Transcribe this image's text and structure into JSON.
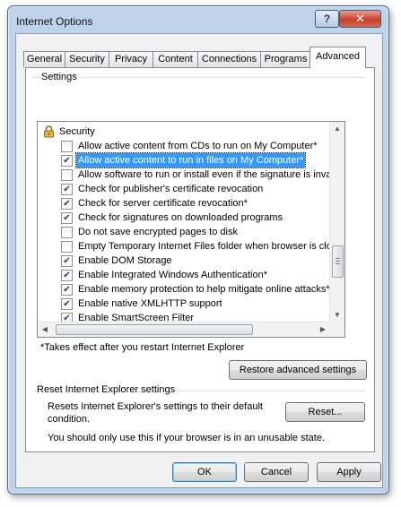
{
  "window": {
    "title": "Internet Options",
    "help_glyph": "?",
    "close_glyph": "✕"
  },
  "tabs": [
    "General",
    "Security",
    "Privacy",
    "Content",
    "Connections",
    "Programs",
    "Advanced"
  ],
  "active_tab": "Advanced",
  "settings_group": {
    "label": "Settings",
    "category": "Security",
    "category_icon": "padlock-icon",
    "items": [
      {
        "label": "Allow active content from CDs to run on My Computer*",
        "checked": false
      },
      {
        "label": "Allow active content to run in files on My Computer*",
        "checked": true,
        "selected": true
      },
      {
        "label": "Allow software to run or install even if the signature is invalid",
        "checked": false
      },
      {
        "label": "Check for publisher's certificate revocation",
        "checked": true
      },
      {
        "label": "Check for server certificate revocation*",
        "checked": true
      },
      {
        "label": "Check for signatures on downloaded programs",
        "checked": true
      },
      {
        "label": "Do not save encrypted pages to disk",
        "checked": false
      },
      {
        "label": "Empty Temporary Internet Files folder when browser is closed",
        "checked": false
      },
      {
        "label": "Enable DOM Storage",
        "checked": true
      },
      {
        "label": "Enable Integrated Windows Authentication*",
        "checked": true
      },
      {
        "label": "Enable memory protection to help mitigate online attacks*",
        "checked": true
      },
      {
        "label": "Enable native XMLHTTP support",
        "checked": true
      },
      {
        "label": "Enable SmartScreen Filter",
        "checked": true
      }
    ]
  },
  "restart_note": "*Takes effect after you restart Internet Explorer",
  "restore_button": "Restore advanced settings",
  "reset_group": {
    "label": "Reset Internet Explorer settings",
    "description_line1": "Resets Internet Explorer's settings to their default",
    "description_line2": "condition.",
    "button": "Reset...",
    "warning": "You should only use this if your browser is in an unusable state."
  },
  "footer": {
    "ok": "OK",
    "cancel": "Cancel",
    "apply": "Apply"
  }
}
